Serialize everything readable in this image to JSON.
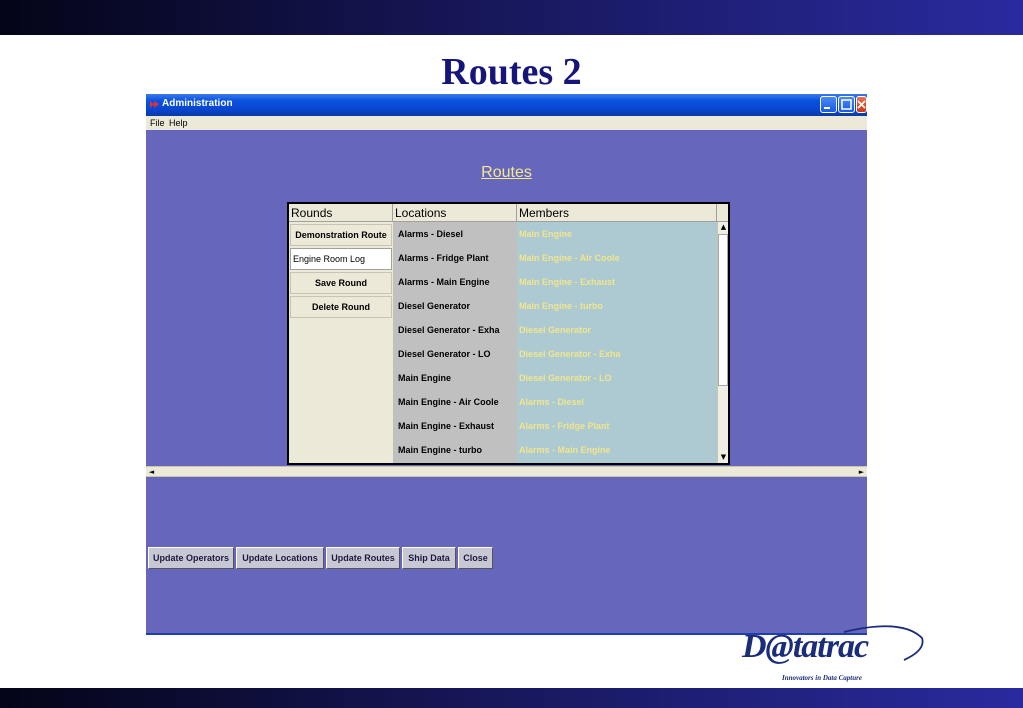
{
  "slide": {
    "title": "Routes 2"
  },
  "window": {
    "title": "Administration",
    "menu": [
      "File",
      "Help"
    ],
    "heading": "Routes"
  },
  "table": {
    "headers": {
      "rounds": "Rounds",
      "locations": "Locations",
      "members": "Members"
    },
    "rounds": {
      "demo_button": "Demonstration Route",
      "name_value": "Engine Room Log",
      "save_button": "Save Round",
      "delete_button": "Delete Round"
    },
    "locations": [
      "Alarms - Diesel",
      "Alarms - Fridge Plant",
      "Alarms - Main Engine",
      "Diesel Generator",
      "Diesel Generator - Exha",
      "Diesel Generator - LO",
      "Main Engine",
      "Main Engine - Air Coole",
      "Main Engine - Exhaust",
      "Main Engine - turbo"
    ],
    "members": [
      "Main Engine",
      "Main Engine - Air Coole",
      "Main Engine - Exhaust",
      "Main Engine - turbo",
      "Diesel Generator",
      "Diesel Generator - Exha",
      "Diesel Generator - LO",
      "Alarms - Diesel",
      "Alarms - Fridge Plant",
      "Alarms - Main Engine"
    ]
  },
  "toolbar": {
    "update_operators": "Update Operators",
    "update_locations": "Update Locations",
    "update_routes": "Update Routes",
    "ship_data": "Ship Data",
    "close": "Close"
  },
  "logo": {
    "name": "D@tatrac",
    "tagline": "Innovators in Data Capture"
  },
  "colors": {
    "window_bg": "#6666bc",
    "heading": "#f4e98a",
    "title_navy": "#16167a"
  }
}
